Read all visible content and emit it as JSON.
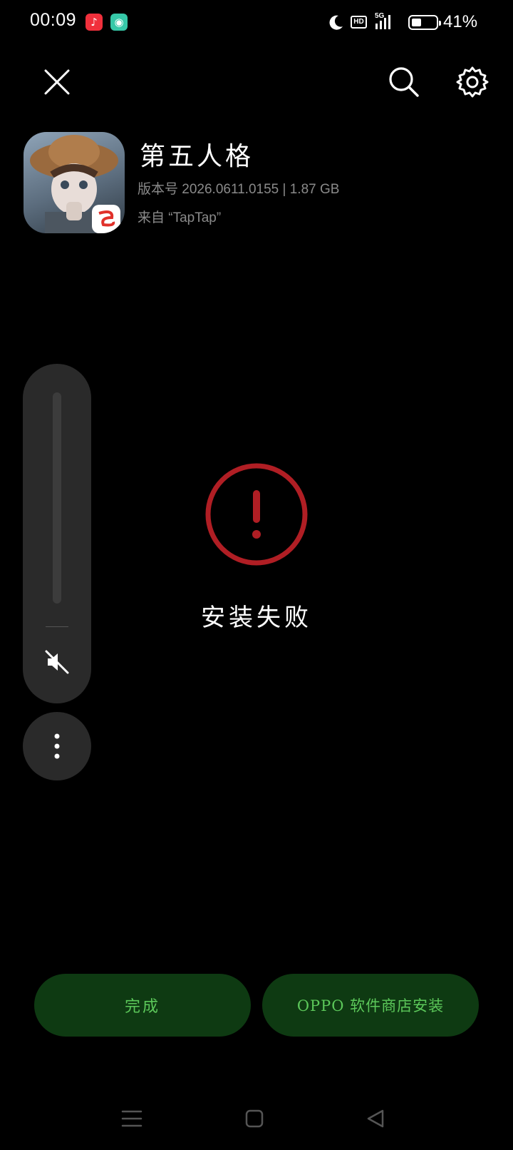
{
  "status_bar": {
    "time": "00:09",
    "network": "5G",
    "hd": "HD",
    "battery_percent": "41%",
    "battery_level": 0.41
  },
  "app": {
    "name": "第五人格",
    "version_line": "版本号 2026.0611.0155 | 1.87 GB",
    "source_line": "来自 “TapTap”"
  },
  "status": {
    "message": "安装失败",
    "color": "#b01e24"
  },
  "buttons": {
    "done": "完成",
    "store_install": "OPPO 软件商店安装"
  },
  "icons": {
    "close": "close-icon",
    "search": "search-icon",
    "settings": "gear-icon",
    "mute": "mute-icon",
    "more": "more-vertical-icon"
  }
}
